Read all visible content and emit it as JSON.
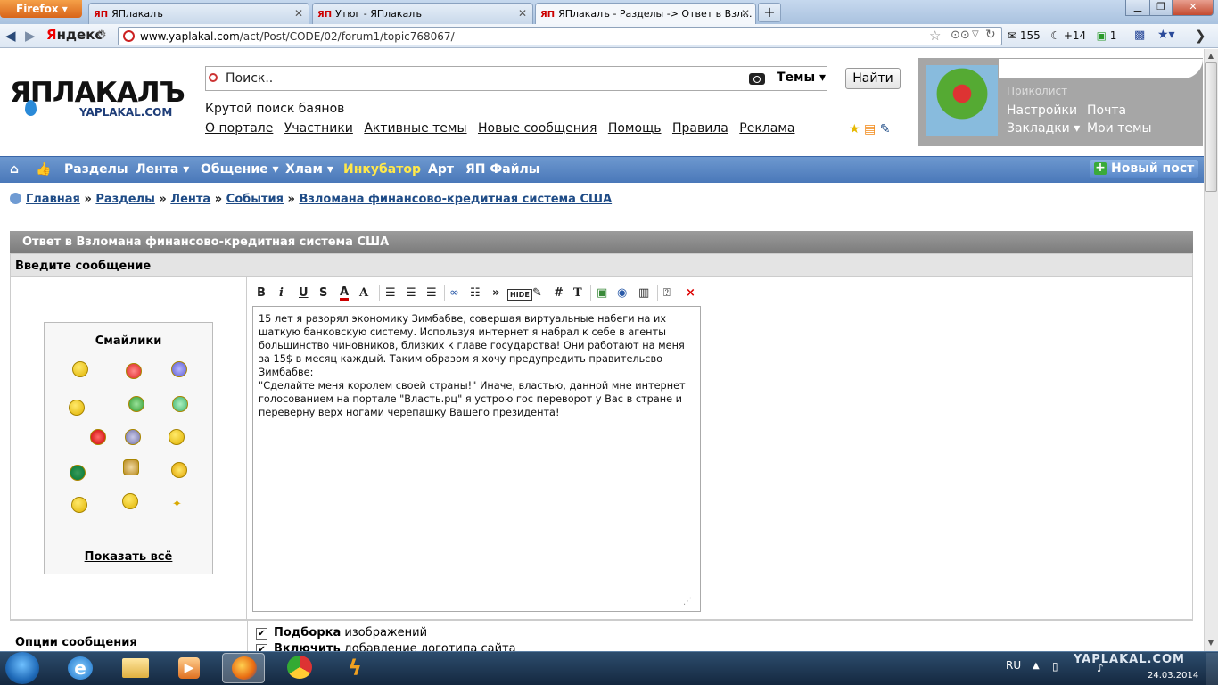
{
  "browser": {
    "menu_button": "Firefox",
    "tabs": [
      {
        "label": "ЯПлакалъ"
      },
      {
        "label": "Утюг - ЯПлакалъ"
      },
      {
        "label": "ЯПлакалъ - Разделы -> Ответ в Взл..."
      }
    ],
    "tab_logo": "ЯП",
    "url_domain": "www.yaplakal.com",
    "url_path": "/act/Post/CODE/02/forum1/topic768067/",
    "yandex_label_1": "Я",
    "yandex_label_2": "ндекс",
    "toolbar_counter_1": "155",
    "toolbar_counter_2": "+14",
    "toolbar_counter_3": "1"
  },
  "header": {
    "logo_text": "ЯПЛАКАЛЪ",
    "logo_sub": "YAPLAKAL.COM",
    "search_placeholder": "Поиск..",
    "search_scope": "Темы",
    "search_button": "Найти",
    "tagline": "Крутой поиск баянов",
    "links": [
      "О портале",
      "Участники",
      "Активные темы",
      "Новые сообщения",
      "Помощь",
      "Правила",
      "Реклама"
    ],
    "user_status": "Приколист",
    "user_links": {
      "settings": "Настройки",
      "mail": "Почта",
      "bookmarks": "Закладки",
      "my_topics": "Мои темы"
    }
  },
  "menu": {
    "items": [
      "Разделы",
      "Лента",
      "Общение",
      "Хлам",
      "Инкубатор",
      "Арт",
      "ЯП Файлы"
    ],
    "new_post": "Новый пост",
    "highlight_color": "#ffe84a"
  },
  "breadcrumb": {
    "items": [
      "Главная",
      "Разделы",
      "Лента",
      "События",
      "Взломана финансово-кредитная система США"
    ],
    "separator": "»"
  },
  "form": {
    "title": "Ответ в Взломана финансово-кредитная система США",
    "subtitle": "Введите сообщение",
    "smilies_title": "Смайлики",
    "show_all": "Показать всё",
    "toolbar_glyphs": [
      "B",
      "i",
      "U",
      "S",
      "A",
      "A",
      "HIDE",
      "#",
      "T",
      "×"
    ],
    "message": "15 лет я разорял экономику Зимбабве, совершая виртуальные набеги на их\nшаткую банковскую систему. Используя интернет я набрал к себе в агенты\nбольшинство чиновников, близких к главе государства! Они работают на меня\nза 15$ в месяц каждый. Таким образом я хочу предупредить правительсво\nЗимбабве:\n\"Сделайте меня королем своей страны!\" Иначе, властью, данной мне интернет\nголосованием на портале \"Власть.рц\" я устрою гос переворот у Вас в стране и\nпереверну верх ногами черепашку Вашего президента!",
    "options_label": "Опции сообщения",
    "option_1_bold": "Подборка",
    "option_1_rest": " изображений",
    "option_2_bold": "Включить",
    "option_2_rest": " добавление логотипа сайта"
  },
  "taskbar": {
    "lang": "RU",
    "watermark": "YAPLAKAL.COM",
    "date": "24.03.2014"
  }
}
